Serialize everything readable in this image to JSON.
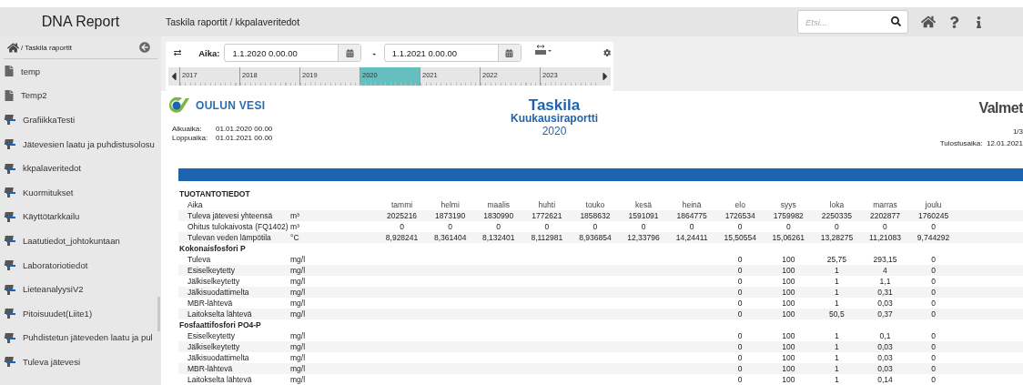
{
  "sidebar": {
    "title": "DNA Report",
    "breadcrumb": "/ Taskila raportit",
    "items": [
      {
        "label": "temp",
        "kind": "folder"
      },
      {
        "label": "Temp2",
        "kind": "folder"
      },
      {
        "label": "GrafiikkaTesti",
        "kind": "report"
      },
      {
        "label": "Jätevesien laatu ja puhdistusolosu",
        "kind": "report"
      },
      {
        "label": "kkpalaveritedot",
        "kind": "report"
      },
      {
        "label": "Kuormitukset",
        "kind": "report"
      },
      {
        "label": "Käyttötarkkailu",
        "kind": "report"
      },
      {
        "label": "Laatutiedot_johtokuntaan",
        "kind": "report"
      },
      {
        "label": "Laboratoriotiedot",
        "kind": "report"
      },
      {
        "label": "LieteanalyysiV2",
        "kind": "report"
      },
      {
        "label": "Pitoisuudet(Liite1)",
        "kind": "report"
      },
      {
        "label": "Puhdistetun jäteveden laatu ja pul",
        "kind": "report"
      },
      {
        "label": "Tuleva jätevesi",
        "kind": "report"
      }
    ]
  },
  "header": {
    "breadcrumb": "Taskila raportit / kkpalaveritedot",
    "search": {
      "placeholder": "Etsi..."
    }
  },
  "toolbar": {
    "time_label": "Aika:",
    "start": "1.1.2020 0.00.00",
    "separator": "-",
    "end": "1.1.2021 0.00.00",
    "timeline": [
      {
        "label": "2017",
        "selected": false
      },
      {
        "label": "2018",
        "selected": false
      },
      {
        "label": "2019",
        "selected": false
      },
      {
        "label": "2020",
        "selected": true
      },
      {
        "label": "2021",
        "selected": false
      },
      {
        "label": "2022",
        "selected": false
      },
      {
        "label": "2023",
        "selected": false
      }
    ]
  },
  "report": {
    "logo_text": "OULUN VESI",
    "title": "Taskila",
    "subtitle": "Kuukausiraportti",
    "year": "2020",
    "brand": "Valmet",
    "start_label": "Alkuaika:",
    "start": "01.01.2020 00.00",
    "end_label": "Loppuaika:",
    "end": "01.01.2021 00.00",
    "page": "1/3",
    "print_label": "Tulostusaika:",
    "print_date": "12.01.2021",
    "sections": [
      {
        "title": "TUOTANTOTIEDOT",
        "rows": [
          {
            "kind": "months",
            "label": "Aika",
            "values": [
              "tammi",
              "helmi",
              "maalis",
              "huhti",
              "touko",
              "kesä",
              "heinä",
              "elo",
              "syys",
              "loka",
              "marras",
              "joulu"
            ]
          },
          {
            "kind": "data",
            "label": "Tuleva jätevesi yhteensä",
            "unit": "m³",
            "values": [
              "2025216",
              "1873190",
              "1830990",
              "1772621",
              "1858632",
              "1591091",
              "1864775",
              "1726534",
              "1759982",
              "2250335",
              "2202877",
              "1760245"
            ]
          },
          {
            "kind": "data",
            "label": "Ohitus tulokaivosta (FQ1402)",
            "unit": "m³",
            "values": [
              "0",
              "0",
              "0",
              "0",
              "0",
              "0",
              "0",
              "0",
              "0",
              "0",
              "0",
              "0"
            ]
          },
          {
            "kind": "data",
            "label": "Tulevan veden lämpötila",
            "unit": "°C",
            "values": [
              "8,928241",
              "8,361404",
              "8,132401",
              "8,112981",
              "8,936854",
              "12,33796",
              "14,24411",
              "15,50554",
              "15,06261",
              "13,28275",
              "11,21083",
              "9,744292"
            ]
          }
        ]
      },
      {
        "title": "Kokonaisfosfori P",
        "rows": [
          {
            "kind": "data",
            "label": "Tuleva",
            "unit": "mg/l",
            "values": [
              "0",
              "100",
              "25,75",
              "293,15",
              "0"
            ]
          },
          {
            "kind": "data",
            "label": "Esiselkeytetty",
            "unit": "mg/l",
            "values": [
              "0",
              "100",
              "1",
              "4",
              "0"
            ]
          },
          {
            "kind": "data",
            "label": "Jälkiselkeytetty",
            "unit": "mg/l",
            "values": [
              "0",
              "100",
              "1",
              "1,1",
              "0"
            ]
          },
          {
            "kind": "data",
            "label": "Jälkisuodattimelta",
            "unit": "mg/l",
            "values": [
              "0",
              "100",
              "1",
              "0,31",
              "0"
            ]
          },
          {
            "kind": "data",
            "label": "MBR-lähtevä",
            "unit": "mg/l",
            "values": [
              "0",
              "100",
              "1",
              "0,03",
              "0"
            ]
          },
          {
            "kind": "data",
            "label": "Laitokselta lähtevä",
            "unit": "mg/l",
            "values": [
              "0",
              "100",
              "50,5",
              "0,37",
              "0"
            ]
          }
        ]
      },
      {
        "title": "Fosfaattifosfori PO4-P",
        "rows": [
          {
            "kind": "data",
            "label": "Esiselkeytetty",
            "unit": "mg/l",
            "values": [
              "0",
              "100",
              "1",
              "0,1",
              "0"
            ]
          },
          {
            "kind": "data",
            "label": "Jälkiselkeytetty",
            "unit": "mg/l",
            "values": [
              "0",
              "100",
              "1",
              "0,03",
              "0"
            ]
          },
          {
            "kind": "data",
            "label": "Jälkisuodattimelta",
            "unit": "mg/l",
            "values": [
              "0",
              "100",
              "1",
              "0,03",
              "0"
            ]
          },
          {
            "kind": "data",
            "label": "MBR-lähtevä",
            "unit": "mg/l",
            "values": [
              "0",
              "100",
              "1",
              "0,03",
              "0"
            ]
          },
          {
            "kind": "data",
            "label": "Laitokselta lähtevä",
            "unit": "mg/l",
            "values": [
              "0",
              "100",
              "1",
              "0,14",
              "0"
            ]
          }
        ]
      }
    ]
  }
}
